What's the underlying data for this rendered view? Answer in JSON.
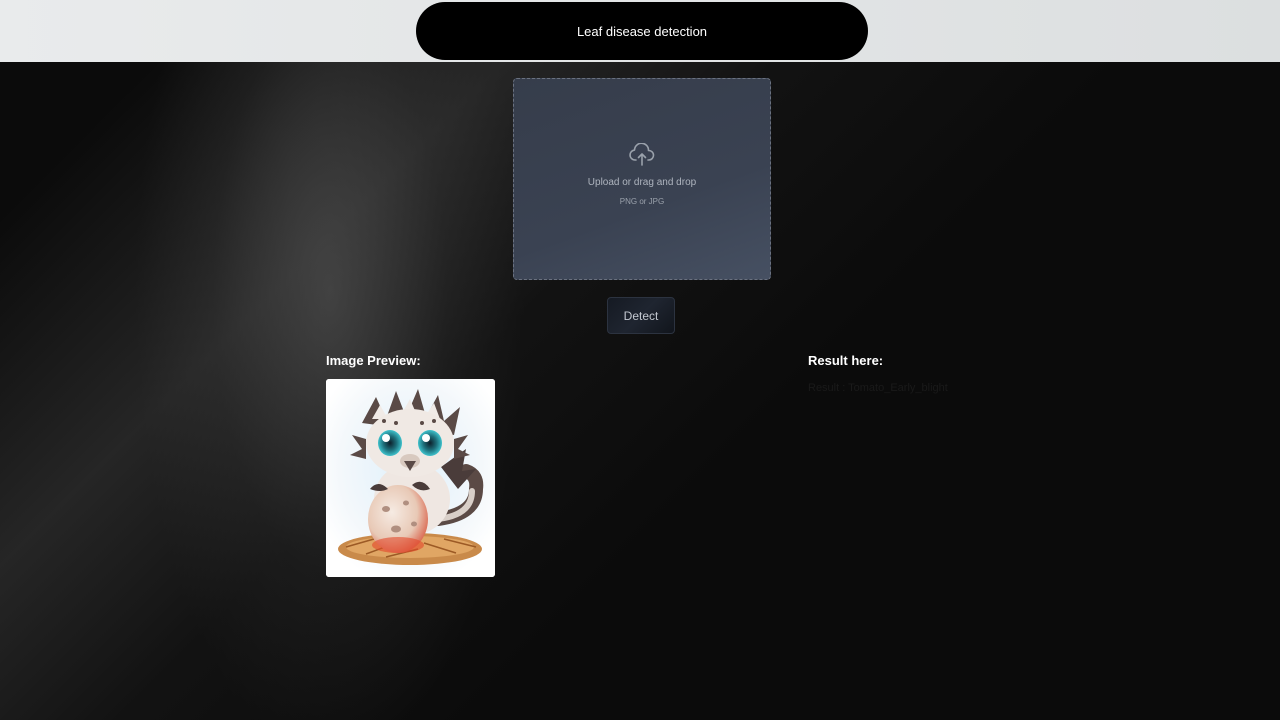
{
  "header": {
    "title": "Leaf disease detection"
  },
  "upload": {
    "icon": "cloud-upload-icon",
    "text": "Upload or drag and drop",
    "formats": "PNG or JPG"
  },
  "actions": {
    "detect_label": "Detect"
  },
  "preview": {
    "label": "Image Preview:",
    "image_description": "cartoon baby dragon with egg"
  },
  "result": {
    "label": "Result here:",
    "value": "Result : Tomato_Early_blight"
  },
  "colors": {
    "background": "#0b0b0b",
    "topbar": "#e2e5e6",
    "pill": "#000000",
    "dropzone": "#3a4252",
    "text_light": "#ffffff"
  }
}
